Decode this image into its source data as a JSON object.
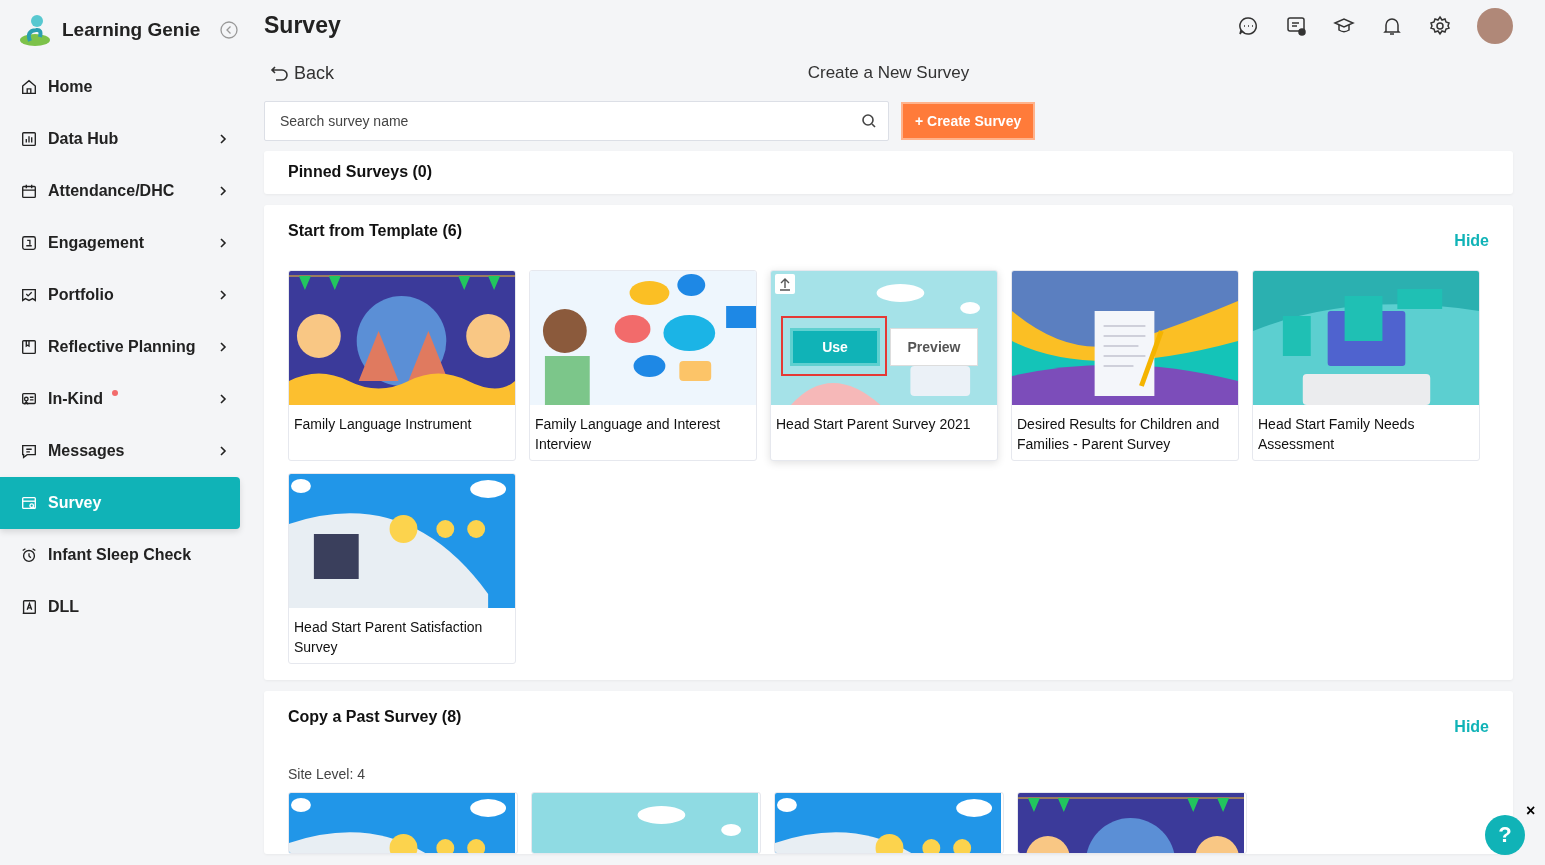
{
  "app": {
    "name": "Learning Genie"
  },
  "sidebar": {
    "items": [
      {
        "label": "Home",
        "submenu": false,
        "dot": false,
        "selected": false
      },
      {
        "label": "Data Hub",
        "submenu": true,
        "dot": false,
        "selected": false
      },
      {
        "label": "Attendance/DHC",
        "submenu": true,
        "dot": false,
        "selected": false
      },
      {
        "label": "Engagement",
        "submenu": true,
        "dot": false,
        "selected": false
      },
      {
        "label": "Portfolio",
        "submenu": true,
        "dot": false,
        "selected": false
      },
      {
        "label": "Reflective Planning",
        "submenu": true,
        "dot": false,
        "selected": false
      },
      {
        "label": "In-Kind",
        "submenu": true,
        "dot": true,
        "selected": false
      },
      {
        "label": "Messages",
        "submenu": true,
        "dot": false,
        "selected": false
      },
      {
        "label": "Survey",
        "submenu": false,
        "dot": false,
        "selected": true
      },
      {
        "label": "Infant Sleep Check",
        "submenu": false,
        "dot": false,
        "selected": false
      },
      {
        "label": "DLL",
        "submenu": false,
        "dot": false,
        "selected": false
      }
    ]
  },
  "header": {
    "title": "Survey"
  },
  "toolbar": {
    "back": "Back",
    "heading": "Create a New Survey",
    "search": {
      "placeholder": "Search survey name"
    },
    "create_button": "+ Create Survey"
  },
  "pinned": {
    "title": "Pinned Surveys (0)"
  },
  "templates": {
    "title": "Start from Template (6)",
    "toggle": "Hide",
    "use_label": "Use",
    "preview_label": "Preview",
    "items": [
      {
        "title": "Family Language Instrument",
        "hovered": false
      },
      {
        "title": "Family Language and Interest Interview",
        "hovered": false
      },
      {
        "title": "Head Start Parent Survey 2021",
        "hovered": true
      },
      {
        "title": "Desired Results for Children and Families - Parent Survey",
        "hovered": false
      },
      {
        "title": "Head Start Family Needs Assessment",
        "hovered": false
      },
      {
        "title": "Head Start Parent Satisfaction Survey",
        "hovered": false
      }
    ]
  },
  "past": {
    "title": "Copy a Past Survey (8)",
    "toggle": "Hide",
    "group_label": "Site Level: 4"
  },
  "help": {
    "label": "?",
    "close": "×"
  }
}
